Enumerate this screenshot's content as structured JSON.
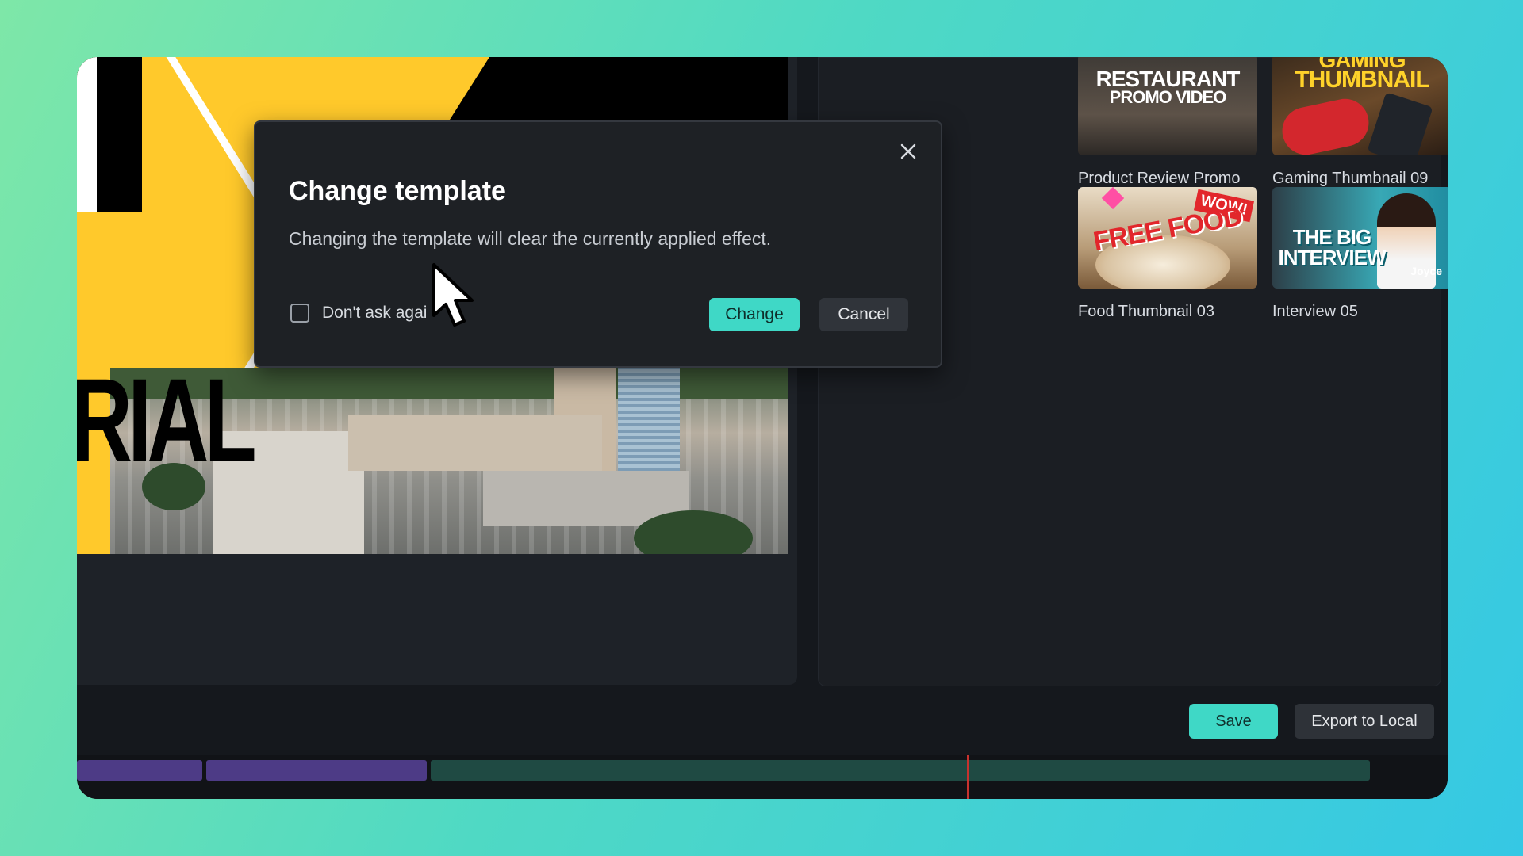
{
  "dialog": {
    "title": "Change template",
    "message": "Changing the template will clear the currently applied effect.",
    "checkbox_label": "Don't ask agai",
    "change_label": "Change",
    "cancel_label": "Cancel",
    "close_icon": "close-icon"
  },
  "preview": {
    "title_text": "RIAL"
  },
  "templates": [
    {
      "label": "Product Review Promo",
      "thumb_line1": "RESTAURANT",
      "thumb_line2": "PROMO VIDEO"
    },
    {
      "label": "Gaming Thumbnail 09",
      "thumb_line1": "GAMING",
      "thumb_line2": "THUMBNAIL"
    },
    {
      "label": "Food Thumbnail 03",
      "thumb_line1": "FREE FOOD",
      "thumb_badge": "WOW!"
    },
    {
      "label": "Interview 05",
      "thumb_line1": "THE BIG INTERVIEW",
      "thumb_tag": "Joyce"
    }
  ],
  "footer": {
    "save_label": "Save",
    "export_label": "Export to Local"
  },
  "colors": {
    "accent": "#3fd8c6",
    "window_bg": "#15181d",
    "playhead": "#c8322e"
  }
}
